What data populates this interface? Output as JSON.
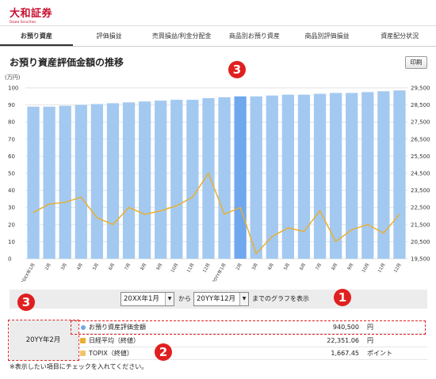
{
  "brand": {
    "name": "大和証券",
    "sub": "Daiwa Securities"
  },
  "tabs": [
    {
      "label": "お預り資産",
      "active": true
    },
    {
      "label": "評価損益",
      "active": false
    },
    {
      "label": "売買損益/利金分配金",
      "active": false
    },
    {
      "label": "商品別お預り資産",
      "active": false
    },
    {
      "label": "商品別評価損益",
      "active": false
    },
    {
      "label": "資産配分状況",
      "active": false
    }
  ],
  "page_title": "お預り資産評価金額の推移",
  "print_label": "印刷",
  "callouts": {
    "one": "1",
    "two": "2",
    "three": "3"
  },
  "chart_data": {
    "type": "bar",
    "categories": [
      "20XX年1月",
      "2月",
      "3月",
      "4月",
      "5月",
      "6月",
      "7月",
      "8月",
      "9月",
      "10月",
      "11月",
      "12月",
      "20YY年1月",
      "2月",
      "3月",
      "4月",
      "5月",
      "6月",
      "7月",
      "8月",
      "9月",
      "10月",
      "11月",
      "12月"
    ],
    "series": [
      {
        "type": "bar",
        "axis": "left",
        "values": [
          89,
          89,
          89.5,
          90,
          90.5,
          91,
          91.5,
          92,
          92.5,
          93,
          93,
          94,
          94.5,
          95,
          95,
          95.5,
          96,
          96,
          96.5,
          97,
          97,
          97.5,
          98,
          98.5
        ]
      },
      {
        "type": "line",
        "axis": "right",
        "values": [
          22200,
          22700,
          22800,
          23100,
          21900,
          21500,
          22500,
          22100,
          22300,
          22600,
          23100,
          24500,
          22100,
          22500,
          19800,
          20800,
          21300,
          21100,
          22300,
          20500,
          21200,
          21500,
          21000,
          22100
        ]
      }
    ],
    "ylabel_left": "(万円)",
    "ylim_left": [
      0,
      100
    ],
    "left_ticks": [
      0,
      10,
      20,
      30,
      40,
      50,
      60,
      70,
      80,
      90,
      100
    ],
    "ylim_right": [
      19500,
      29500
    ],
    "right_ticks": [
      "19,500",
      "20,500",
      "21,500",
      "22,500",
      "23,500",
      "24,500",
      "25,500",
      "26,500",
      "27,500",
      "28,500",
      "29,500"
    ],
    "highlight_index": 13,
    "grid": true,
    "colors": {
      "bar": "#a3c9f1",
      "bar_highlight": "#6fa8ee",
      "line": "#e6b033",
      "grid": "#e2e2e2"
    }
  },
  "period": {
    "from": "20XX年1月",
    "from_sep": "から",
    "to": "20YY年12月",
    "suffix": "までのグラフを表示"
  },
  "summary": {
    "date": "20YY年2月",
    "rows": [
      {
        "label": "お預り資産評価金額",
        "value": "940,500",
        "unit": "円",
        "marker": "dot",
        "color": "#6fa8ee"
      },
      {
        "label": "日経平均（終値）",
        "value": "22,351.06",
        "unit": "円",
        "marker": "check",
        "color": "#e6b033"
      },
      {
        "label": "TOPIX（終値）",
        "value": "1,667.45",
        "unit": "ポイント",
        "marker": "check",
        "color": "#f2c46a"
      }
    ]
  },
  "note": "※表示したい項目にチェックを入れてください。"
}
